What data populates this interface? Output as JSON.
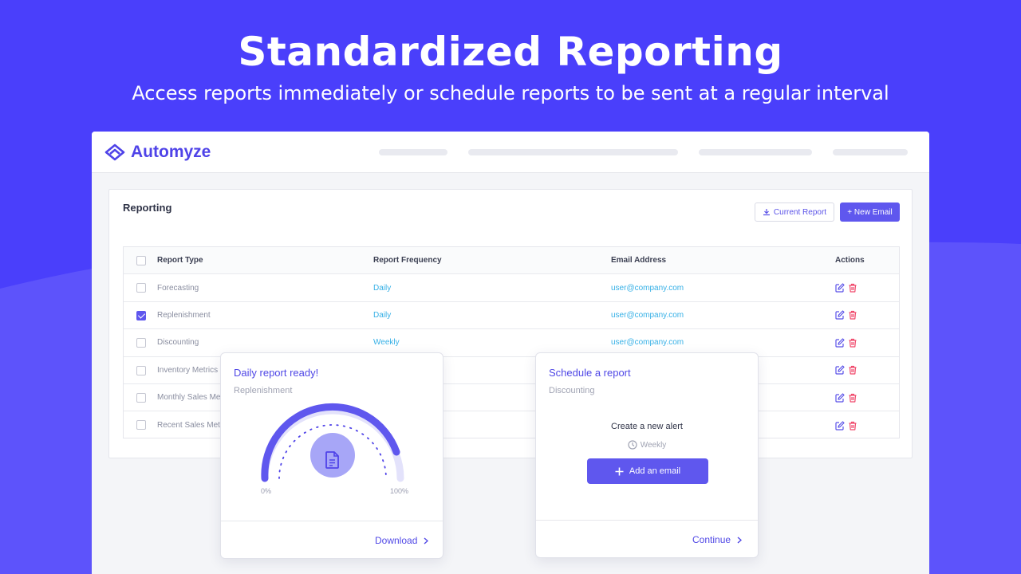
{
  "hero": {
    "title": "Standardized Reporting",
    "subtitle": "Access reports immediately or schedule reports to be sent at a regular interval"
  },
  "brand": {
    "name": "Automyze",
    "accent": "#4f43e8",
    "background": "#4a3ffb"
  },
  "reporting": {
    "title": "Reporting",
    "current_report_label": "Current Report",
    "new_email_label": "+ New Email",
    "columns": [
      "Report Type",
      "Report Frequency",
      "Email Address",
      "Actions"
    ],
    "rows": [
      {
        "type": "Forecasting",
        "frequency": "Daily",
        "email": "user@company.com",
        "checked": false
      },
      {
        "type": "Replenishment",
        "frequency": "Daily",
        "email": "user@company.com",
        "checked": true
      },
      {
        "type": "Discounting",
        "frequency": "Weekly",
        "email": "user@company.com",
        "checked": false
      },
      {
        "type": "Inventory Metrics",
        "frequency": "",
        "email": "",
        "checked": false
      },
      {
        "type": "Monthly Sales Me",
        "frequency": "",
        "email": "",
        "checked": false
      },
      {
        "type": "Recent Sales Met",
        "frequency": "",
        "email": "",
        "checked": false
      }
    ]
  },
  "daily_card": {
    "title": "Daily report ready!",
    "subtitle": "Replenishment",
    "gauge_min_label": "0%",
    "gauge_max_label": "100%",
    "download_label": "Download"
  },
  "schedule_card": {
    "title": "Schedule a report",
    "subtitle": "Discounting",
    "alert_title": "Create a new alert",
    "frequency": "Weekly",
    "add_email_label": "Add an email",
    "continue_label": "Continue"
  }
}
